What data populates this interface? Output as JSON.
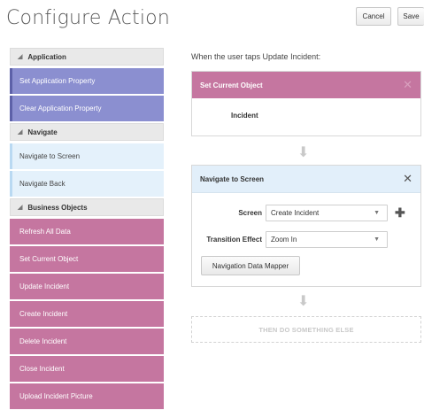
{
  "header": {
    "title": "Configure Action",
    "cancel_label": "Cancel",
    "save_label": "Save"
  },
  "palette": {
    "groups": [
      {
        "label": "Application",
        "items": [
          "Set Application Property",
          "Clear Application Property"
        ]
      },
      {
        "label": "Navigate",
        "items": [
          "Navigate to Screen",
          "Navigate Back"
        ]
      },
      {
        "label": "Business Objects",
        "items": [
          "Refresh All Data",
          "Set Current Object",
          "Update Incident",
          "Create Incident",
          "Delete Incident",
          "Close Incident",
          "Upload Incident Picture"
        ]
      }
    ]
  },
  "canvas": {
    "intro": "When the user taps Update Incident:",
    "step1": {
      "title": "Set Current Object",
      "value": "Incident",
      "close_glyph": "✕"
    },
    "step2": {
      "title": "Navigate to Screen",
      "close_glyph": "✕",
      "screen_label": "Screen",
      "screen_value": "Create Incident",
      "transition_label": "Transition Effect",
      "transition_value": "Zoom In",
      "mapper_label": "Navigation Data Mapper",
      "add_glyph": "✚"
    },
    "arrow_glyph": "⬇",
    "then_label": "THEN DO SOMETHING ELSE"
  },
  "colors": {
    "application": "#8b8fd0",
    "navigate": "#e4f1fb",
    "business_objects": "#c576a0"
  }
}
